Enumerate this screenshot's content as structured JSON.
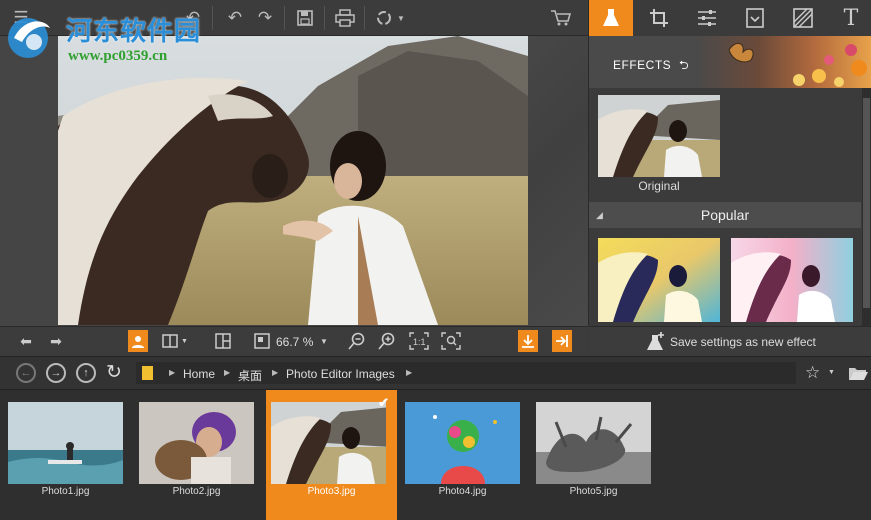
{
  "watermark": {
    "title": "河东软件园",
    "url": "www.pc0359.cn"
  },
  "effects_panel": {
    "header_label": "EFFECTS",
    "original_label": "Original",
    "popular_label": "Popular",
    "save_settings_label": "Save settings as new effect"
  },
  "toolbar": {
    "zoom_value": "66.7 %"
  },
  "breadcrumb": {
    "items": [
      "Home",
      "桌面",
      "Photo Editor Images"
    ]
  },
  "filmstrip": {
    "items": [
      {
        "label": "Photo1.jpg"
      },
      {
        "label": "Photo2.jpg"
      },
      {
        "label": "Photo3.jpg",
        "selected": true
      },
      {
        "label": "Photo4.jpg"
      },
      {
        "label": "Photo5.jpg"
      }
    ]
  },
  "colors": {
    "accent": "#f08a1c",
    "panel": "#3b3b3b",
    "background": "#454545"
  }
}
